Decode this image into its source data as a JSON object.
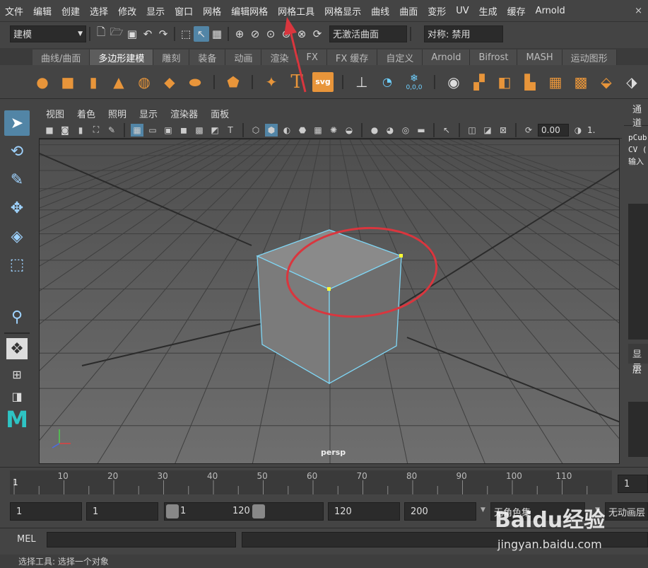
{
  "menubar": {
    "items": [
      "文件",
      "编辑",
      "创建",
      "选择",
      "修改",
      "显示",
      "窗口",
      "网格",
      "编辑网格",
      "网格工具",
      "网格显示",
      "曲线",
      "曲面",
      "变形",
      "UV",
      "生成",
      "缓存",
      "Arnold"
    ],
    "close": "×"
  },
  "statusline": {
    "mode": "建模",
    "live_surface": "无激活曲面",
    "symmetry": "对称: 禁用"
  },
  "shelf": {
    "tabs": [
      "曲线/曲面",
      "多边形建模",
      "雕刻",
      "装备",
      "动画",
      "渲染",
      "FX",
      "FX 缓存",
      "自定义",
      "Arnold",
      "Bifrost",
      "MASH",
      "运动图形"
    ],
    "active_tab": 1,
    "text_icon": "T",
    "svg_icon": "svg",
    "coord_label": "0,0,0"
  },
  "panel": {
    "menu": [
      "视图",
      "着色",
      "照明",
      "显示",
      "渲染器",
      "面板"
    ],
    "exposure": "0.00",
    "gamma": "1.",
    "camera_label": "persp"
  },
  "rightpanel": {
    "channel_tab": "通道",
    "lines": [
      "pCub",
      "CV (",
      "输入"
    ],
    "layer_tab": "显示",
    "layer_label": "层"
  },
  "timeslider": {
    "ticks": [
      "10",
      "20",
      "30",
      "40",
      "50",
      "60",
      "70",
      "80",
      "90",
      "100",
      "110"
    ],
    "current_marker": "1",
    "current_frame": "1"
  },
  "rangeslider": {
    "start": "1",
    "range_start": "1",
    "range_inner_start": "1",
    "range_inner_end": "120",
    "range_end": "120",
    "anim_end": "200",
    "character_set": "无角色集",
    "anim_layer": "无动画层"
  },
  "melbar": {
    "label": "MEL"
  },
  "helpline": {
    "text": "选择工具: 选择一个对象"
  },
  "watermark": {
    "brand": "Baidu经验",
    "url": "jingyan.baidu.com"
  },
  "colors": {
    "accent": "#5285a6",
    "annotation": "#d9363e",
    "cube_edge": "#7fd6f5",
    "vertex": "#ffff33"
  }
}
